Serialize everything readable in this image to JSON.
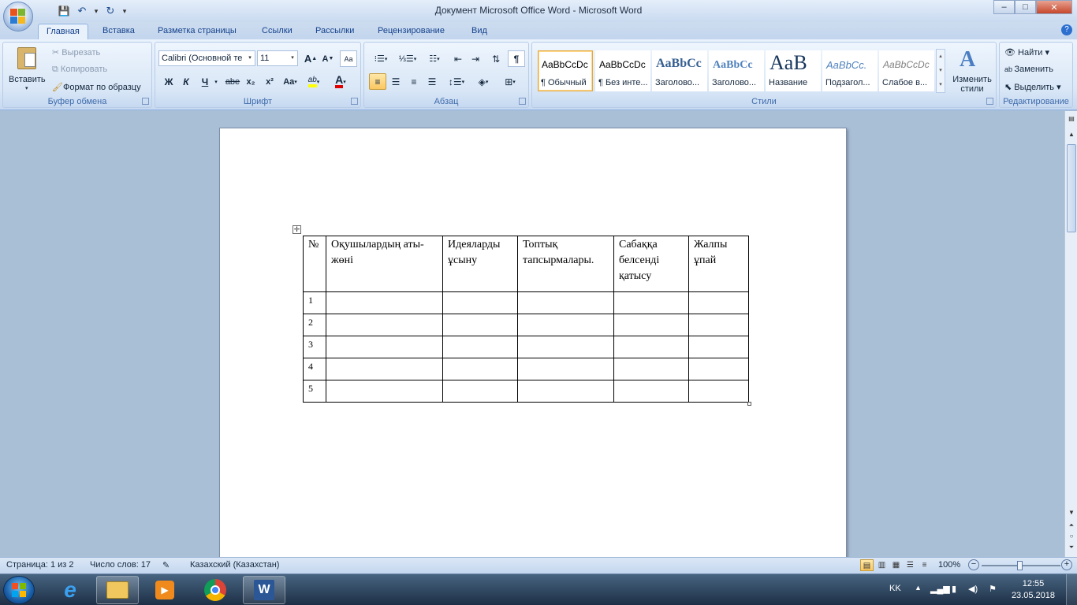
{
  "window": {
    "title": "Документ Microsoft Office Word - Microsoft Word",
    "controls": {
      "minimize": "‒",
      "maximize": "□",
      "close": "✕"
    }
  },
  "qat": {
    "save": "💾",
    "undo": "↶",
    "redo": "↻",
    "more": "▾"
  },
  "tabs": [
    "Главная",
    "Вставка",
    "Разметка страницы",
    "Ссылки",
    "Рассылки",
    "Рецензирование",
    "Вид"
  ],
  "ribbon": {
    "clipboard": {
      "label": "Буфер обмена",
      "paste": "Вставить",
      "cut": "Вырезать",
      "copy": "Копировать",
      "format_painter": "Формат по образцу"
    },
    "font": {
      "label": "Шрифт",
      "name": "Calibri (Основной те",
      "size": "11",
      "grow": "A",
      "shrink": "A",
      "clear": "Aa",
      "bold": "Ж",
      "italic": "К",
      "underline": "Ч",
      "strike": "abe",
      "subscript": "x₂",
      "superscript": "x²",
      "case": "Aa",
      "highlight": "ab",
      "color": "A"
    },
    "paragraph": {
      "label": "Абзац",
      "pilcrow": "¶"
    },
    "styles": {
      "label": "Стили",
      "items": [
        {
          "sample": "AaBbCcDc",
          "name": "¶ Обычный"
        },
        {
          "sample": "AaBbCcDc",
          "name": "¶ Без инте..."
        },
        {
          "sample": "AaBbCc",
          "name": "Заголово..."
        },
        {
          "sample": "AaBbCc",
          "name": "Заголово..."
        },
        {
          "sample": "AaB",
          "name": "Название"
        },
        {
          "sample": "AaBbCc.",
          "name": "Подзагол..."
        },
        {
          "sample": "AaBbCcDc",
          "name": "Слабое в..."
        }
      ],
      "change_styles": "Изменить стили"
    },
    "editing": {
      "label": "Редактирование",
      "find": "Найти",
      "replace": "Заменить",
      "select": "Выделить"
    }
  },
  "document": {
    "table": {
      "headers": [
        "№",
        "Оқушылардың аты-жөні",
        "Идеяларды ұсыну",
        "Топтық тапсырмалары.",
        "Сабаққа белсенді қатысу",
        "Жалпы ұпай"
      ],
      "rows": [
        [
          "1",
          "",
          "",
          "",
          "",
          ""
        ],
        [
          "2",
          "",
          "",
          "",
          "",
          ""
        ],
        [
          "3",
          "",
          "",
          "",
          "",
          ""
        ],
        [
          "4",
          "",
          "",
          "",
          "",
          ""
        ],
        [
          "5",
          "",
          "",
          "",
          "",
          ""
        ]
      ]
    }
  },
  "status": {
    "page": "Страница: 1 из 2",
    "words": "Число слов: 17",
    "language": "Казахский (Казахстан)",
    "zoom": "100%",
    "zoom_level": 1.0
  },
  "taskbar": {
    "lang": "KK",
    "time": "12:55",
    "date": "23.05.2018"
  },
  "colors": {
    "ribbon_label": "#3e6aaa",
    "tab_text": "#15428b",
    "font_color_bar": "#e00000",
    "highlight_bar": "#ffff00"
  }
}
